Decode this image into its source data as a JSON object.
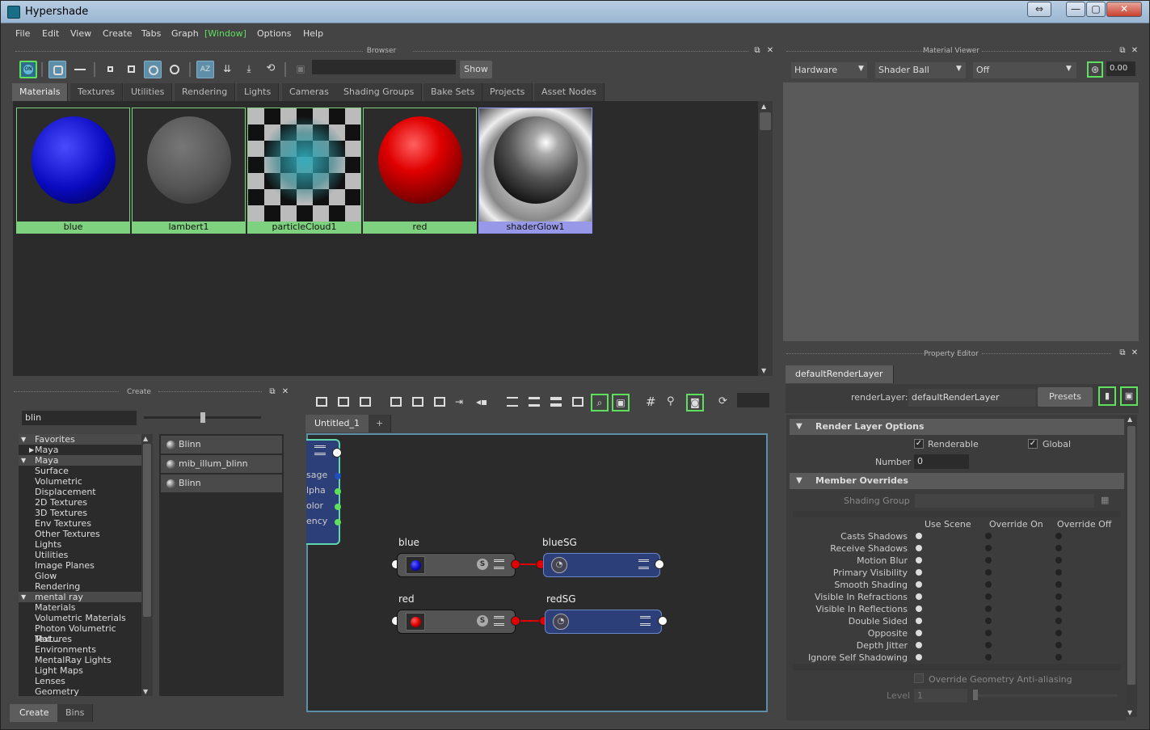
{
  "window": {
    "title": "Hypershade",
    "buttons": [
      "⇔",
      "—",
      "▢",
      "✕"
    ]
  },
  "menus": [
    "File",
    "Edit",
    "View",
    "Create",
    "Tabs",
    "Graph",
    "[Window]",
    "Options",
    "Help"
  ],
  "browser": {
    "title": "Browser",
    "show_label": "Show",
    "search_value": "",
    "tabs": [
      "Materials",
      "Textures",
      "Utilities",
      "Rendering",
      "Lights",
      "Cameras",
      "Shading Groups",
      "Bake Sets",
      "Projects",
      "Asset Nodes"
    ],
    "active_tab": "Materials",
    "swatches": [
      {
        "name": "blue",
        "color": "#1010d0"
      },
      {
        "name": "lambert1",
        "color": "#6a6a6a"
      },
      {
        "name": "particleCloud1",
        "color": "#30a8b8"
      },
      {
        "name": "red",
        "color": "#e00000"
      },
      {
        "name": "shaderGlow1",
        "color": "#cccccc"
      }
    ]
  },
  "material_viewer": {
    "title": "Material Viewer",
    "renderer": "Hardware",
    "geometry": "Shader Ball",
    "env": "Off",
    "exposure": "0.00"
  },
  "create_panel": {
    "title": "Create",
    "search_value": "blin",
    "tree": [
      {
        "label": "Favorites",
        "header": true,
        "expanded": true
      },
      {
        "label": "Maya",
        "indent": 1,
        "collapsed": true
      },
      {
        "label": "Maya",
        "header": true,
        "expanded": true
      },
      {
        "label": "Surface"
      },
      {
        "label": "Volumetric"
      },
      {
        "label": "Displacement"
      },
      {
        "label": "2D Textures"
      },
      {
        "label": "3D Textures"
      },
      {
        "label": "Env Textures"
      },
      {
        "label": "Other Textures"
      },
      {
        "label": "Lights"
      },
      {
        "label": "Utilities"
      },
      {
        "label": "Image Planes"
      },
      {
        "label": "Glow"
      },
      {
        "label": "Rendering"
      },
      {
        "label": "mental ray",
        "header": true,
        "expanded": true
      },
      {
        "label": "Materials"
      },
      {
        "label": "Volumetric Materials"
      },
      {
        "label": "Photon Volumetric Mat..."
      },
      {
        "label": "Textures"
      },
      {
        "label": "Environments"
      },
      {
        "label": "MentalRay Lights"
      },
      {
        "label": "Light Maps"
      },
      {
        "label": "Lenses"
      },
      {
        "label": "Geometry"
      }
    ],
    "nodes": [
      "Blinn",
      "mib_illum_blinn",
      "Blinn"
    ],
    "bottom_tabs": [
      "Create",
      "Bins"
    ]
  },
  "graph": {
    "tab": "Untitled_1",
    "add_tab": "+",
    "partial_ports": [
      "sage",
      "lpha",
      "olor",
      "ency"
    ],
    "nodes": [
      {
        "name": "blue",
        "sg": "blueSG",
        "ball": "#1010d0"
      },
      {
        "name": "red",
        "sg": "redSG",
        "ball": "#e00000"
      }
    ],
    "s_label": "S"
  },
  "property_editor": {
    "title": "Property Editor",
    "tab": "defaultRenderLayer",
    "layer_label": "renderLayer:",
    "layer_value": "defaultRenderLayer",
    "presets": "Presets",
    "section1": "Render Layer Options",
    "renderable": "Renderable",
    "global": "Global",
    "number_label": "Number",
    "number_value": "0",
    "section2": "Member Overrides",
    "shading_group": "Shading Group",
    "cols": [
      "Use Scene",
      "Override On",
      "Override Off"
    ],
    "rows": [
      "Casts Shadows",
      "Receive Shadows",
      "Motion Blur",
      "Primary Visibility",
      "Smooth Shading",
      "Visible In Refractions",
      "Visible In Reflections",
      "Double Sided",
      "Opposite",
      "Depth Jitter",
      "Ignore Self Shadowing"
    ],
    "override_aa": "Override Geometry Anti-aliasing",
    "level_label": "Level",
    "level_value": "1"
  },
  "colors": {
    "accent": "#5ee05e",
    "swatch_border": "#7ed17e",
    "sg_blue": "#2d3f78",
    "conn_red": "#e00000"
  }
}
